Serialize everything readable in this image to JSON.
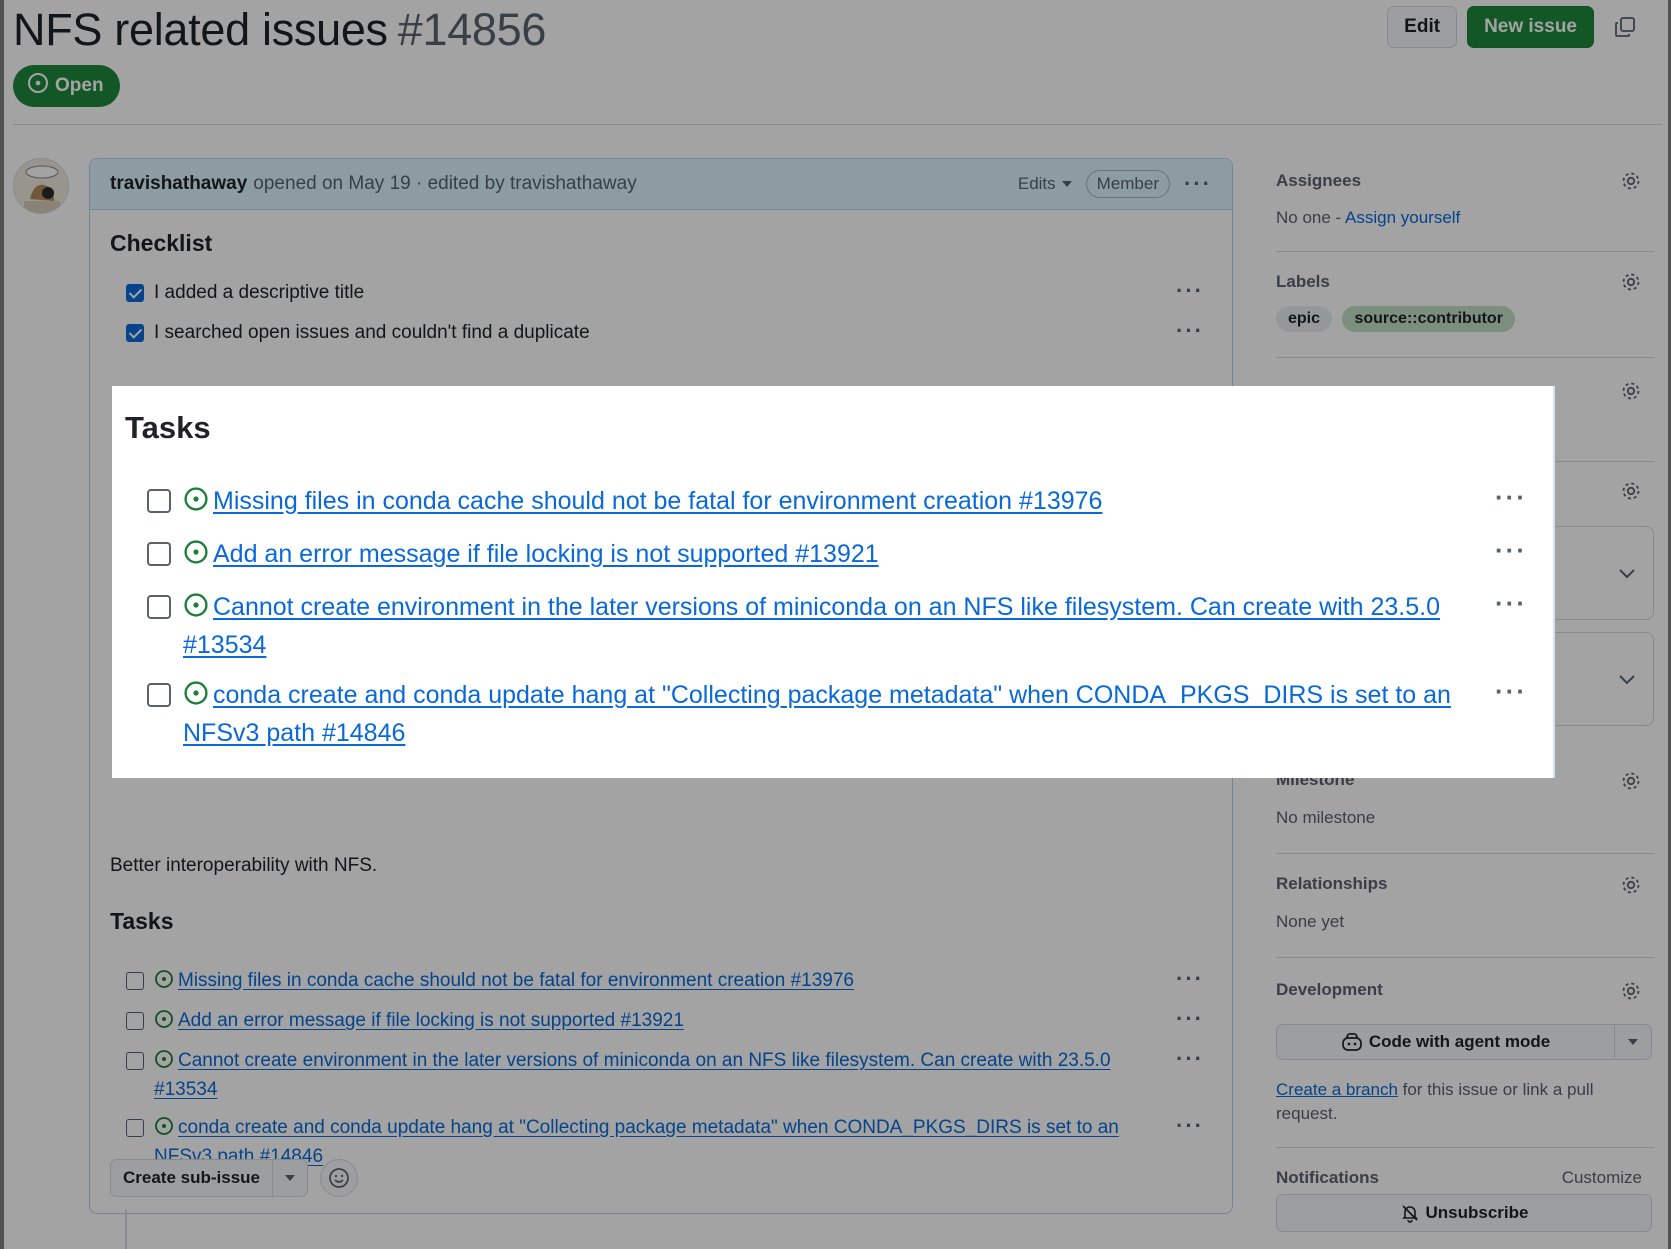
{
  "issue": {
    "title": "NFS related issues",
    "number": "#14856",
    "state": "Open",
    "edit_label": "Edit",
    "new_issue_label": "New issue"
  },
  "comment": {
    "author": "travishathaway",
    "meta": "opened on May 19 · edited by travishathaway",
    "edits_label": "Edits",
    "role_badge": "Member",
    "checklist_title": "Checklist",
    "checklist": [
      {
        "text": "I added a descriptive title",
        "checked": true
      },
      {
        "text": "I searched open issues and couldn't find a duplicate",
        "checked": true
      }
    ],
    "outcome_text": "Better interoperability with NFS.",
    "tasks_title": "Tasks",
    "tasks": [
      {
        "text": "Missing files in conda cache should not be fatal for environment creation #13976",
        "checked": false
      },
      {
        "text": "Add an error message if file locking is not supported #13921",
        "checked": false
      },
      {
        "text": "Cannot create environment in the later versions of miniconda on an NFS like filesystem. Can create with 23.5.0 #13534",
        "checked": false
      },
      {
        "text": "conda create and conda update hang at \"Collecting package metadata\" when CONDA_PKGS_DIRS is set to an NFSv3 path #14846",
        "checked": false
      }
    ],
    "create_sub_issue_label": "Create sub-issue"
  },
  "sidebar": {
    "assignees": {
      "title": "Assignees",
      "value_prefix": "No one - ",
      "assign_link": "Assign yourself"
    },
    "labels": {
      "title": "Labels",
      "items": [
        {
          "name": "epic",
          "color": "#eaeef2"
        },
        {
          "name": "source::contributor",
          "color": "#c2e0c6"
        }
      ]
    },
    "milestone": {
      "title": "Milestone",
      "value": "No milestone"
    },
    "relationships": {
      "title": "Relationships",
      "value": "None yet"
    },
    "development": {
      "title": "Development",
      "agent_button": "Code with agent mode",
      "create_branch_link": "Create a branch",
      "create_branch_rest": " for this issue or link a pull request."
    },
    "notifications": {
      "title": "Notifications",
      "customize": "Customize",
      "unsubscribe": "Unsubscribe"
    }
  },
  "colors": {
    "accent": "#0969da",
    "open_green": "#1f883d",
    "header_bg": "#ddf4ff"
  },
  "zoom_callout": {
    "title": "Tasks"
  }
}
